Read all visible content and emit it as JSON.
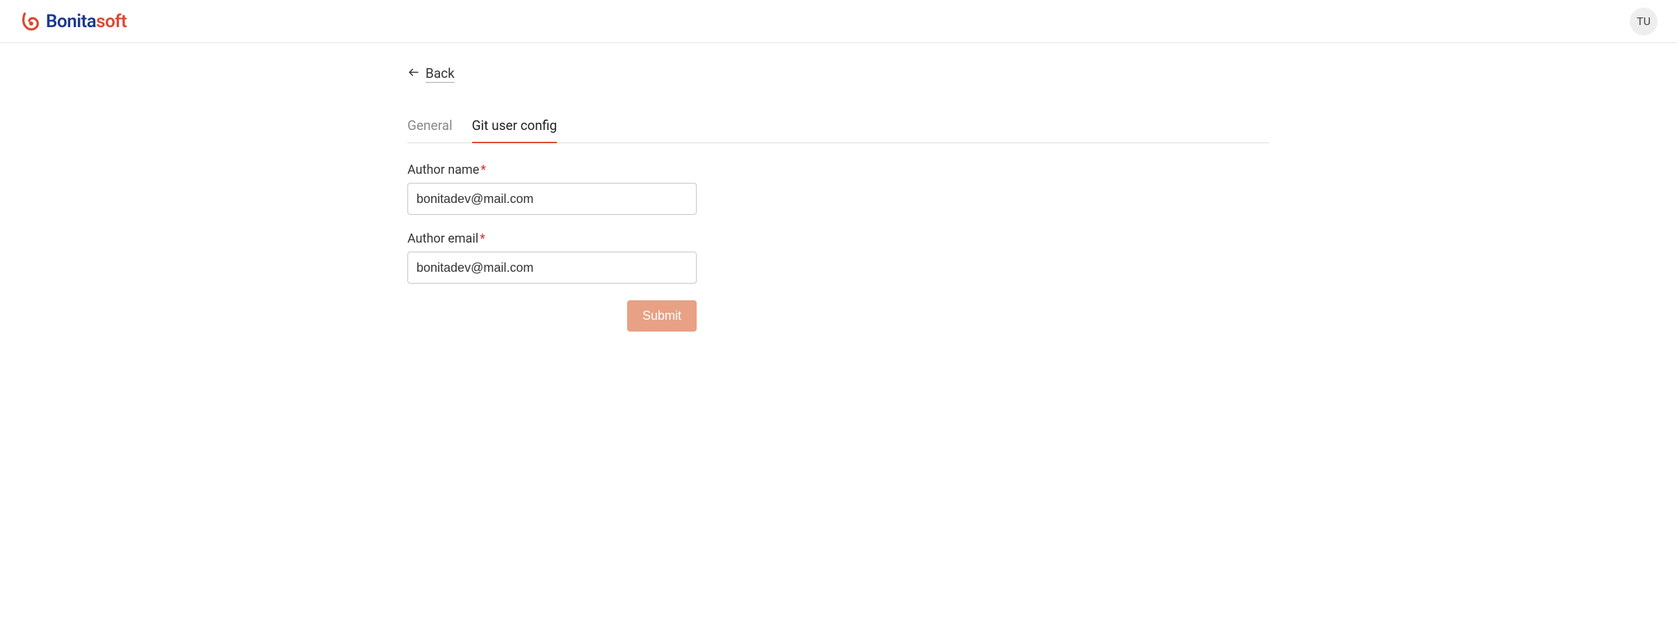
{
  "header": {
    "logo_bonita": "Bonita",
    "logo_soft": "soft",
    "avatar_initials": "TU"
  },
  "nav": {
    "back_label": "Back"
  },
  "tabs": {
    "general": "General",
    "git_user_config": "Git user config"
  },
  "form": {
    "author_name_label": "Author name",
    "author_name_value": "bonitadev@mail.com",
    "author_email_label": "Author email",
    "author_email_value": "bonitadev@mail.com",
    "required_mark": "*",
    "submit_label": "Submit"
  }
}
